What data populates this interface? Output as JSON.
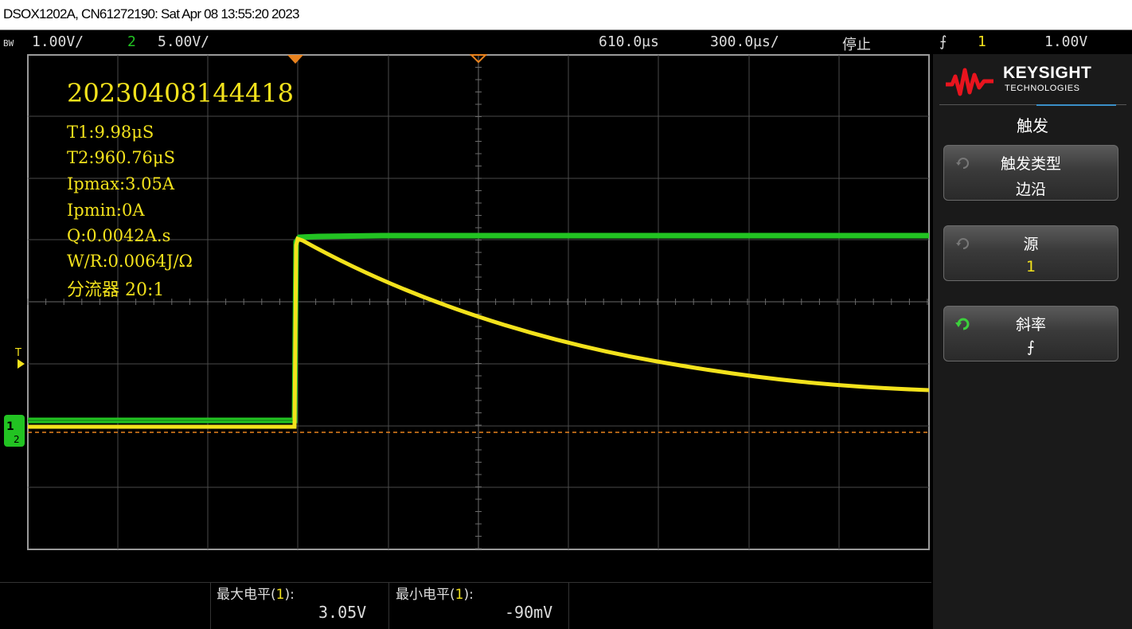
{
  "title_bar": "DSOX1202A, CN61272190: Sat Apr 08 13:55:20 2023",
  "status": {
    "bw": "BW",
    "ch1_scale": "1.00V/",
    "ch2_number": "2",
    "ch2_scale": "5.00V/",
    "time_delay": "610.0µs",
    "time_scale": "300.0µs/",
    "run_state": "停止",
    "trigger_slope_symbol": "⨍",
    "trigger_source": "1",
    "trigger_level": "1.00V"
  },
  "annotation": {
    "timestamp": "20230408144418",
    "lines": [
      "T1:9.98μS",
      "T2:960.76μS",
      "Ipmax:3.05A",
      "Ipmin:0A",
      "Q:0.0042A.s",
      "W/R:0.0064J/Ω",
      "分流器 20:1"
    ]
  },
  "markers": {
    "trigger_level_label": "T",
    "ch1_ground_label": "1",
    "ch2_ground_label": "2"
  },
  "logo": {
    "brand": "KEYSIGHT",
    "sub": "TECHNOLOGIES"
  },
  "softkey_panel": {
    "title": "触发",
    "keys": [
      {
        "label": "触发类型",
        "value": "边沿"
      },
      {
        "label": "源",
        "value": "1"
      },
      {
        "label": "斜率",
        "value": "⨍"
      }
    ]
  },
  "measurements": [
    {
      "label_prefix": "最大电平(",
      "channel": "1",
      "label_suffix": "):",
      "value": "3.05V"
    },
    {
      "label_prefix": "最小电平(",
      "channel": "1",
      "label_suffix": "):",
      "value": "-90mV"
    }
  ],
  "colors": {
    "ch1": "#f3e21c",
    "ch2": "#22c322",
    "trigger_line": "#e8821e",
    "grid": "#4a4a4a"
  }
}
